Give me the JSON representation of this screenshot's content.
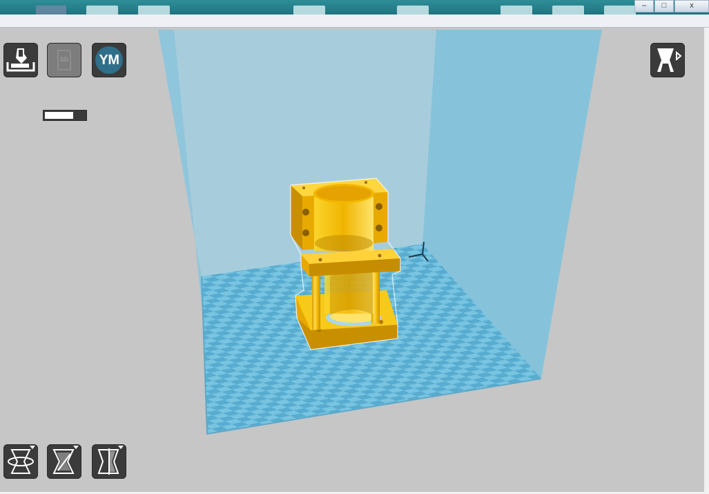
{
  "window": {
    "controls": {
      "minimize": "–",
      "maximize": "□",
      "close": "x"
    }
  },
  "toolbar": {
    "load_icon": "load-model-icon",
    "sd_icon": "sd-card-icon",
    "sd_label": "SD",
    "ym_label": "YM",
    "view_icon": "view-mode-icon",
    "progress_fraction": 0.7
  },
  "tools": {
    "rotate_icon": "rotate-tool-icon",
    "scale_icon": "scale-tool-icon",
    "mirror_icon": "mirror-tool-icon"
  },
  "colors": {
    "model": "#f5c000",
    "build_volume": "#7fc2dc",
    "plate_light": "#7dc7e2",
    "plate_dark": "#5aaed0",
    "background": "#c6c6c6",
    "button_bg": "#3b3b3b",
    "accent": "#1f7480"
  }
}
